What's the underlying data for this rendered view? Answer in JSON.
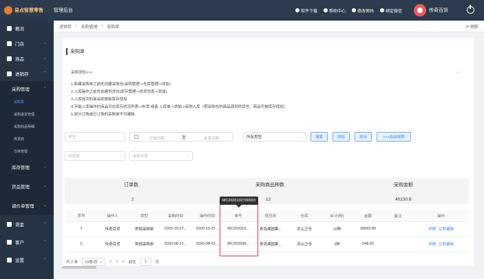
{
  "app": {
    "logo_text": "易点智慧零售",
    "admin_title": "管理后台"
  },
  "top_actions": [
    {
      "label": "软件下载",
      "icon": "monitor-icon"
    },
    {
      "label": "帮助中心",
      "icon": "help-icon"
    },
    {
      "label": "修改密码",
      "icon": "key-icon"
    },
    {
      "label": "绑定微信",
      "icon": "wechat-icon"
    }
  ],
  "user": {
    "name": "传奇百货"
  },
  "sidebar": {
    "items": [
      {
        "label": "概况",
        "icon": "home-icon"
      },
      {
        "label": "门店",
        "icon": "store-icon"
      },
      {
        "label": "商品",
        "icon": "menu-icon"
      },
      {
        "label": "进销存",
        "icon": "inventory-icon"
      }
    ],
    "procurement": {
      "label": "采购管理",
      "children": [
        "采购单",
        "采购退货管理",
        "采购商品明细",
        "供货商",
        "仓库管理"
      ]
    },
    "groups": [
      "库存管理",
      "货品管理",
      "调价单管理"
    ],
    "bottom": [
      {
        "label": "资金",
        "icon": "fund-icon"
      },
      {
        "label": "客户",
        "icon": "customer-icon"
      },
      {
        "label": "设置",
        "icon": "gear-icon"
      }
    ]
  },
  "breadcrumb": [
    "进销存",
    "采购管理",
    "采购单"
  ],
  "refresh_label": "刷新",
  "page_title": "采购单",
  "notice": {
    "title": "采购须知>>>",
    "lines": [
      "1.新建采购单之前先创建采购仓(采购管理->仓库管理->添加)",
      "2.入库操作之前先创建供货仓(库存管理->供货仓库->添加)",
      "3.入库成功的商品即更新库存增加",
      "4.不能入库操作的商品可在库存状况列表->补货 或者 入库单->添加->采购入库（把采购仓的商品调到供货仓，商品可被库存增加）",
      "5.部分订购或已订购的采购单不可编辑"
    ]
  },
  "filters": {
    "order_no_placeholder": "单号",
    "start_date_placeholder": "开始日期",
    "range_separator": "至",
    "end_date_placeholder": "结束日期",
    "type_value": "所有类型",
    "supplier_placeholder": "供货商",
    "warehouse_placeholder": "采购仓库",
    "search_label": "搜索",
    "add_label": "添加",
    "export_label": "导出",
    "advanced_label": ">>>高级搜索"
  },
  "summary": {
    "order_count_label": "订单数",
    "order_count": "2",
    "product_kinds_label": "采购商品种数",
    "product_kinds": "12",
    "amount_label": "采购金额",
    "amount": "40230.8"
  },
  "table": {
    "headers": [
      "序号",
      "操作人",
      "类型",
      "采购时间",
      "操作时间",
      "单号",
      "供应商",
      "仓库",
      "合计(种)",
      "金额",
      "备注",
      "操作"
    ],
    "rows": [
      [
        "1",
        "传奇百货",
        "常规采购单",
        "2020-10-27...",
        "2020-10-27...",
        "MC202010...",
        "青岛满园果...",
        "灵山卫仓",
        "10种",
        "39682.80",
        "",
        ""
      ],
      [
        "2",
        "传奇百货",
        "常规采购单",
        "2020-08-21...",
        "2020-08-21...",
        "MC202008...",
        "青岛满园果...",
        "灵山卫仓",
        "2种",
        "548.00",
        "",
        ""
      ]
    ],
    "row_actions": {
      "detail": "详情",
      "edit": "立即编辑"
    }
  },
  "tooltip": "MC2020102700003",
  "pager": {
    "total": "共 2 条",
    "page_size": "10条/页",
    "prev": "<",
    "current": "1",
    "next": ">",
    "goto_label": "前往",
    "goto_value": "1",
    "page_suffix": "页"
  }
}
